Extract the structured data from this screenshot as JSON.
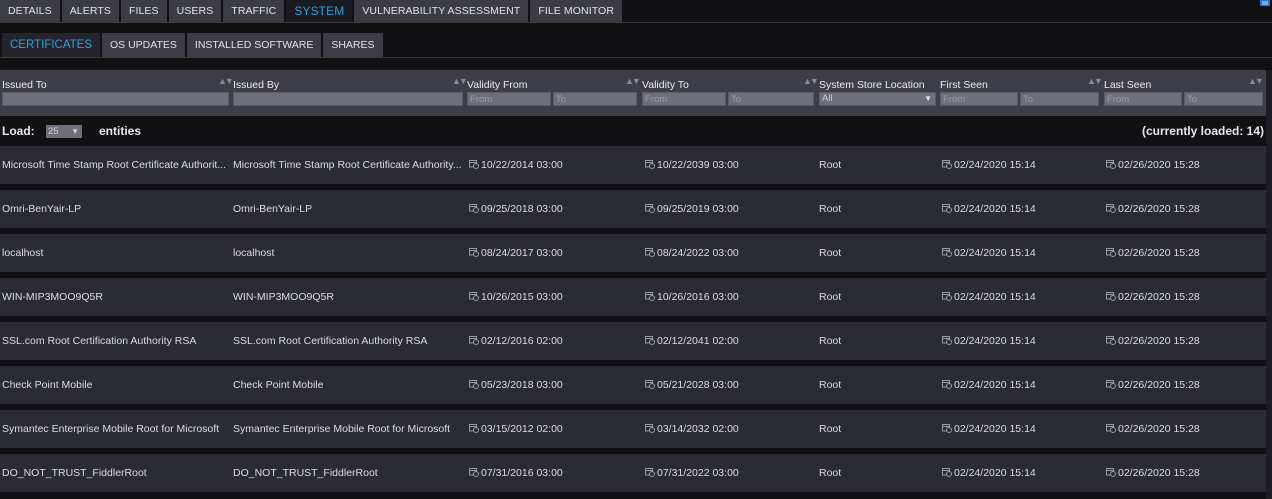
{
  "tabs": [
    {
      "label": "DETAILS",
      "active": false
    },
    {
      "label": "ALERTS",
      "active": false
    },
    {
      "label": "FILES",
      "active": false
    },
    {
      "label": "USERS",
      "active": false
    },
    {
      "label": "TRAFFIC",
      "active": false
    },
    {
      "label": "SYSTEM",
      "active": true
    },
    {
      "label": "VULNERABILITY ASSESSMENT",
      "active": false
    },
    {
      "label": "FILE MONITOR",
      "active": false
    }
  ],
  "subtabs": [
    {
      "label": "CERTIFICATES",
      "active": true
    },
    {
      "label": "OS UPDATES",
      "active": false
    },
    {
      "label": "INSTALLED SOFTWARE",
      "active": false
    },
    {
      "label": "SHARES",
      "active": false
    }
  ],
  "columns": {
    "issued_to": "Issued To",
    "issued_by": "Issued By",
    "validity_from": "Validity From",
    "validity_to": "Validity To",
    "store": "System Store Location",
    "first_seen": "First Seen",
    "last_seen": "Last Seen"
  },
  "filters": {
    "from_placeholder": "From",
    "to_placeholder": "To",
    "store_selected": "All"
  },
  "load": {
    "label": "Load:",
    "value": "25",
    "entities_label": "entities",
    "loaded_text": "(currently loaded: 14)"
  },
  "icons": {
    "date": "calendar-clock-icon",
    "sort": "sort-arrows-icon",
    "corner": "expand-panel-icon"
  },
  "colors": {
    "accent": "#2f9fe0",
    "tab_bg": "#3b3c44",
    "row_bg": "#2b2c33",
    "panel_bg": "#3d3e47"
  },
  "rows": [
    {
      "issued_to": "Microsoft Time Stamp Root Certificate Authorit...",
      "issued_by": "Microsoft Time Stamp Root Certificate Authority...",
      "validity_from": "10/22/2014 03:00",
      "validity_to": "10/22/2039 03:00",
      "store": "Root",
      "first_seen": "02/24/2020 15:14",
      "last_seen": "02/26/2020 15:28"
    },
    {
      "issued_to": "Omri-BenYair-LP",
      "issued_by": "Omri-BenYair-LP",
      "validity_from": "09/25/2018 03:00",
      "validity_to": "09/25/2019 03:00",
      "store": "Root",
      "first_seen": "02/24/2020 15:14",
      "last_seen": "02/26/2020 15:28"
    },
    {
      "issued_to": "localhost",
      "issued_by": "localhost",
      "validity_from": "08/24/2017 03:00",
      "validity_to": "08/24/2022 03:00",
      "store": "Root",
      "first_seen": "02/24/2020 15:14",
      "last_seen": "02/26/2020 15:28"
    },
    {
      "issued_to": "WIN-MIP3MOO9Q5R",
      "issued_by": "WIN-MIP3MOO9Q5R",
      "validity_from": "10/26/2015 03:00",
      "validity_to": "10/26/2016 03:00",
      "store": "Root",
      "first_seen": "02/24/2020 15:14",
      "last_seen": "02/26/2020 15:28"
    },
    {
      "issued_to": "SSL.com Root Certification Authority RSA",
      "issued_by": "SSL.com Root Certification Authority RSA",
      "validity_from": "02/12/2016 02:00",
      "validity_to": "02/12/2041 02:00",
      "store": "Root",
      "first_seen": "02/24/2020 15:14",
      "last_seen": "02/26/2020 15:28"
    },
    {
      "issued_to": "Check Point Mobile",
      "issued_by": "Check Point Mobile",
      "validity_from": "05/23/2018 03:00",
      "validity_to": "05/21/2028 03:00",
      "store": "Root",
      "first_seen": "02/24/2020 15:14",
      "last_seen": "02/26/2020 15:28"
    },
    {
      "issued_to": "Symantec Enterprise Mobile Root for Microsoft",
      "issued_by": "Symantec Enterprise Mobile Root for Microsoft",
      "validity_from": "03/15/2012 02:00",
      "validity_to": "03/14/2032 02:00",
      "store": "Root",
      "first_seen": "02/24/2020 15:14",
      "last_seen": "02/26/2020 15:28"
    },
    {
      "issued_to": "DO_NOT_TRUST_FiddlerRoot",
      "issued_by": "DO_NOT_TRUST_FiddlerRoot",
      "validity_from": "07/31/2016 03:00",
      "validity_to": "07/31/2022 03:00",
      "store": "Root",
      "first_seen": "02/24/2020 15:14",
      "last_seen": "02/26/2020 15:28"
    }
  ]
}
